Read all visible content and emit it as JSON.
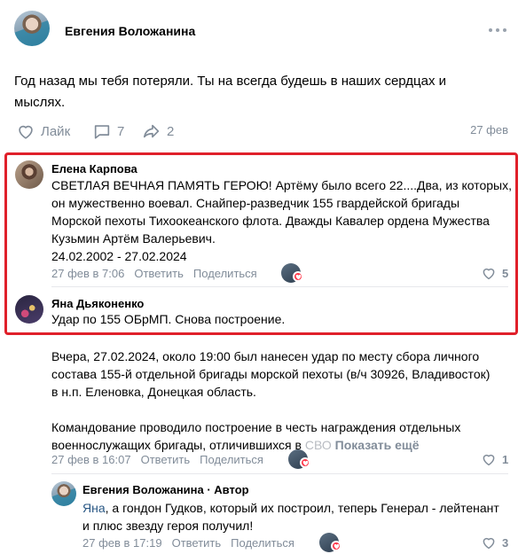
{
  "post": {
    "author": "Евгения Воложанина",
    "text": "Год назад мы тебя потеряли. Ты на всегда будешь в наших сердцах и мыслях.",
    "like_label": "Лайк",
    "comments_count": "7",
    "shares_count": "2",
    "date": "27 фев"
  },
  "comments": [
    {
      "author": "Елена Карпова",
      "text_lines": [
        "СВЕТЛАЯ ВЕЧНАЯ ПАМЯТЬ ГЕРОЮ! Артёму было всего 22....Два, из которых,",
        "он мужественно воевал. Снайпер-разведчик 155 гвардейской бригады",
        "Морской пехоты Тихоокеанского флота. Дважды Кавалер ордена Мужества",
        "Кузьмин Артём Валерьевич.",
        "24.02.2002 - 27.02.2024"
      ],
      "date": "27 фев в 7:06",
      "reply_label": "Ответить",
      "share_label": "Поделиться",
      "likes": "5"
    },
    {
      "author": "Яна Дьяконенко",
      "text": "Удар по 155 ОБрМП. Снова построение.",
      "text_lines_2": [
        "Вчера, 27.02.2024, около 19:00 был нанесен удар по месту сбора личного",
        "состава 155-й отдельной бригады морской пехоты (в/ч 30926, Владивосток)",
        "в н.п. Еленовка, Донецкая область.",
        "Командование проводило построение в честь награждения отдельных",
        "военнослужащих бригады, отличившихся в СВО"
      ],
      "truncated_tail": "СВО",
      "show_more": "Показать ещё",
      "date": "27 фев в 16:07",
      "reply_label": "Ответить",
      "share_label": "Поделиться",
      "likes": "1"
    },
    {
      "author": "Евгения Воложанина · Автор",
      "reply_to": "Яна",
      "text_line1": ", а гондон Гудков, который их построил, теперь Генерал - лейтенант",
      "text_line2": "и плюс звезду героя получил!",
      "date": "27 фев в 17:19",
      "reply_label": "Ответить",
      "share_label": "Поделиться",
      "likes": "3"
    }
  ],
  "icons": {
    "more": "more-horizontal-icon",
    "like": "heart-outline-icon",
    "comment": "comment-icon",
    "share": "share-arrow-icon",
    "liker_heart": "heart-filled-icon"
  },
  "colors": {
    "accent_red": "#e0202a",
    "secondary_text": "#818c99",
    "link": "#2a5885",
    "heart": "#ff3347"
  }
}
